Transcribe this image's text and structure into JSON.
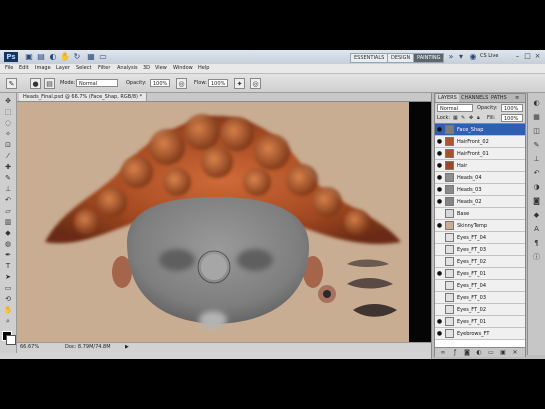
{
  "titlebar": {
    "logo": "Ps",
    "workspaces": [
      "ESSENTIALS",
      "DESIGN",
      "PAINTING"
    ],
    "active_workspace": "PAINTING",
    "search_label": "CS Live",
    "controls": [
      "–",
      "□",
      "×"
    ]
  },
  "menubar": {
    "items": [
      "File",
      "Edit",
      "Image",
      "Layer",
      "Select",
      "Filter",
      "Analysis",
      "3D",
      "View",
      "Window",
      "Help"
    ]
  },
  "options": {
    "mode_label": "Mode:",
    "mode_value": "Normal",
    "opacity_label": "Opacity:",
    "opacity_value": "100%",
    "flow_label": "Flow:",
    "flow_value": "100%"
  },
  "document": {
    "tab_label": "Heads_Final.psd @ 66.7% (Face_Shap, RGB/8) *",
    "zoom": "66.67%",
    "doc_size": "Doc: 8.79M/74.8M"
  },
  "layers": {
    "tabs": [
      "LAYERS",
      "CHANNELS",
      "PATHS"
    ],
    "blend_mode": "Normal",
    "opacity_label": "Opacity:",
    "opacity": "100%",
    "lock_label": "Lock:",
    "fill_label": "Fill:",
    "fill": "100%",
    "items": [
      {
        "name": "Face_Shap",
        "visible": true,
        "selected": true,
        "thumb": "#7c7c7c"
      },
      {
        "name": "HairFront_02",
        "visible": true,
        "selected": false,
        "thumb": "#b0552d"
      },
      {
        "name": "HairFront_01",
        "visible": true,
        "selected": false,
        "thumb": "#a8502a"
      },
      {
        "name": "Hair",
        "visible": true,
        "selected": false,
        "thumb": "#9c4a26"
      },
      {
        "name": "Heads_04",
        "visible": true,
        "selected": false,
        "thumb": "#8f8f8f"
      },
      {
        "name": "Heads_03",
        "visible": true,
        "selected": false,
        "thumb": "#8a8a8a"
      },
      {
        "name": "Heads_02",
        "visible": true,
        "selected": false,
        "thumb": "#858585"
      },
      {
        "name": "Base",
        "visible": false,
        "selected": false,
        "thumb": "#d8d8d8"
      },
      {
        "name": "SkinnyTemp",
        "visible": true,
        "selected": false,
        "thumb": "#c9ad92"
      },
      {
        "name": "Eyes_FT_04",
        "visible": false,
        "selected": false,
        "thumb": "#e2e2e2"
      },
      {
        "name": "Eyes_FT_03",
        "visible": false,
        "selected": false,
        "thumb": "#e2e2e2"
      },
      {
        "name": "Eyes_FT_02",
        "visible": false,
        "selected": false,
        "thumb": "#e2e2e2"
      },
      {
        "name": "Eyes_FT_01",
        "visible": true,
        "selected": false,
        "thumb": "#e2e2e2"
      },
      {
        "name": "Eyes_FT_04",
        "visible": false,
        "selected": false,
        "thumb": "#e2e2e2"
      },
      {
        "name": "Eyes_FT_03",
        "visible": false,
        "selected": false,
        "thumb": "#e2e2e2"
      },
      {
        "name": "Eyes_FT_02",
        "visible": false,
        "selected": false,
        "thumb": "#e2e2e2"
      },
      {
        "name": "Eyes_FT_01",
        "visible": true,
        "selected": false,
        "thumb": "#e2e2e2"
      },
      {
        "name": "Eyebrows_FT",
        "visible": true,
        "selected": false,
        "thumb": "#e2e2e2"
      }
    ]
  },
  "colors": {
    "canvas_bg": "#c9ad92",
    "hair": "#b0552d",
    "skin": "#8a8a8a",
    "selection": "#2f5eb5"
  }
}
